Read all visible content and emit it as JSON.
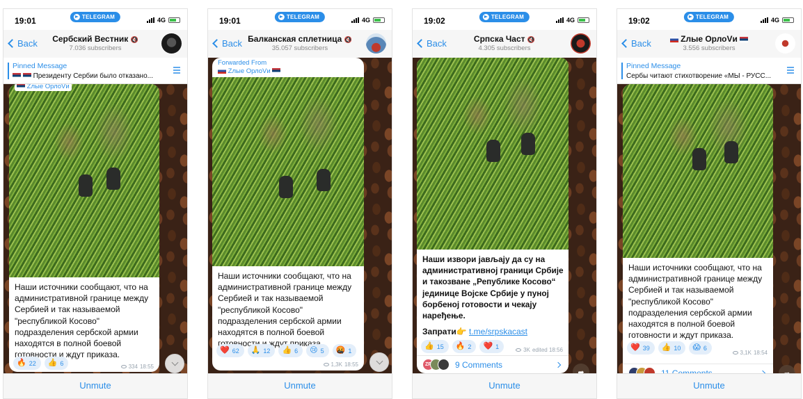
{
  "brand_color": "#2b8ee8",
  "common": {
    "tg_label": "TELEGRAM",
    "network": "4G",
    "back_label": "Back",
    "pinned_label": "Pinned Message",
    "unmute_label": "Unmute",
    "forwarded_label": "Forwarded From"
  },
  "panels": [
    {
      "time": "19:01",
      "channel_title": "Сербский Вестник",
      "subscribers": "7.036 subscribers",
      "pinned_text": "Президенту Сербии было отказано...",
      "forward_source": "Zлые ОрлоVи",
      "message": "Наши источники сообщают, что на административной границе между Сербией и так называемой \"республикой Косово\" подразделения сербской армии находятся в полной боевой готовности и ждут приказа.",
      "reactions": [
        {
          "emoji": "🔥",
          "count": "22"
        },
        {
          "emoji": "👍",
          "count": "6"
        }
      ],
      "views": "334",
      "time_sent": "18:55"
    },
    {
      "time": "19:01",
      "channel_title": "Балканская сплетница",
      "subscribers": "35.057 subscribers",
      "forward_source": "Zлые ОрлоVи",
      "message": "Наши источники сообщают, что на административной границе между Сербией и так называемой \"республикой Косово\" подразделения сербской армии находятся в полной боевой готовности и ждут приказа.",
      "reactions": [
        {
          "emoji": "❤️",
          "count": "62"
        },
        {
          "emoji": "🙏",
          "count": "12"
        },
        {
          "emoji": "👍",
          "count": "6"
        },
        {
          "emoji": "😢",
          "count": "5"
        },
        {
          "emoji": "🤬",
          "count": "1"
        }
      ],
      "views": "1,3K",
      "time_sent": "18:55"
    },
    {
      "time": "19:02",
      "channel_title": "Српска Част",
      "subscribers": "4.305 subscribers",
      "message": "Наши извори јављају да су на административној граници Србије и такозване „Републике Косово“ јединице Војске Србије у пуној борбеној готовости и чекају наређење.",
      "share_label": "Запрати👉",
      "share_link": "t.me/srpskacast",
      "reactions": [
        {
          "emoji": "👍",
          "count": "15"
        },
        {
          "emoji": "🔥",
          "count": "2"
        },
        {
          "emoji": "❤️",
          "count": "1"
        }
      ],
      "views": "3K",
      "time_sent": "edited 18:56",
      "comments": "9 Comments",
      "commenter_initials": "ZP"
    },
    {
      "time": "19:02",
      "channel_title": "Zлые ОрлоVи",
      "subscribers": "3.556 subscribers",
      "pinned_text": "Сербы читают стихотворение «МЫ - РУСС...",
      "message": "Наши источники сообщают, что на административной границе между Сербией и так называемой \"республикой Косово\" подразделения сербской армии находятся в полной боевой готовности и ждут приказа.",
      "reactions": [
        {
          "emoji": "❤️",
          "count": "39"
        },
        {
          "emoji": "👍",
          "count": "10"
        },
        {
          "emoji": "😱",
          "count": "6"
        }
      ],
      "views": "3,1K",
      "time_sent": "18:54",
      "comments": "11 Comments"
    }
  ]
}
